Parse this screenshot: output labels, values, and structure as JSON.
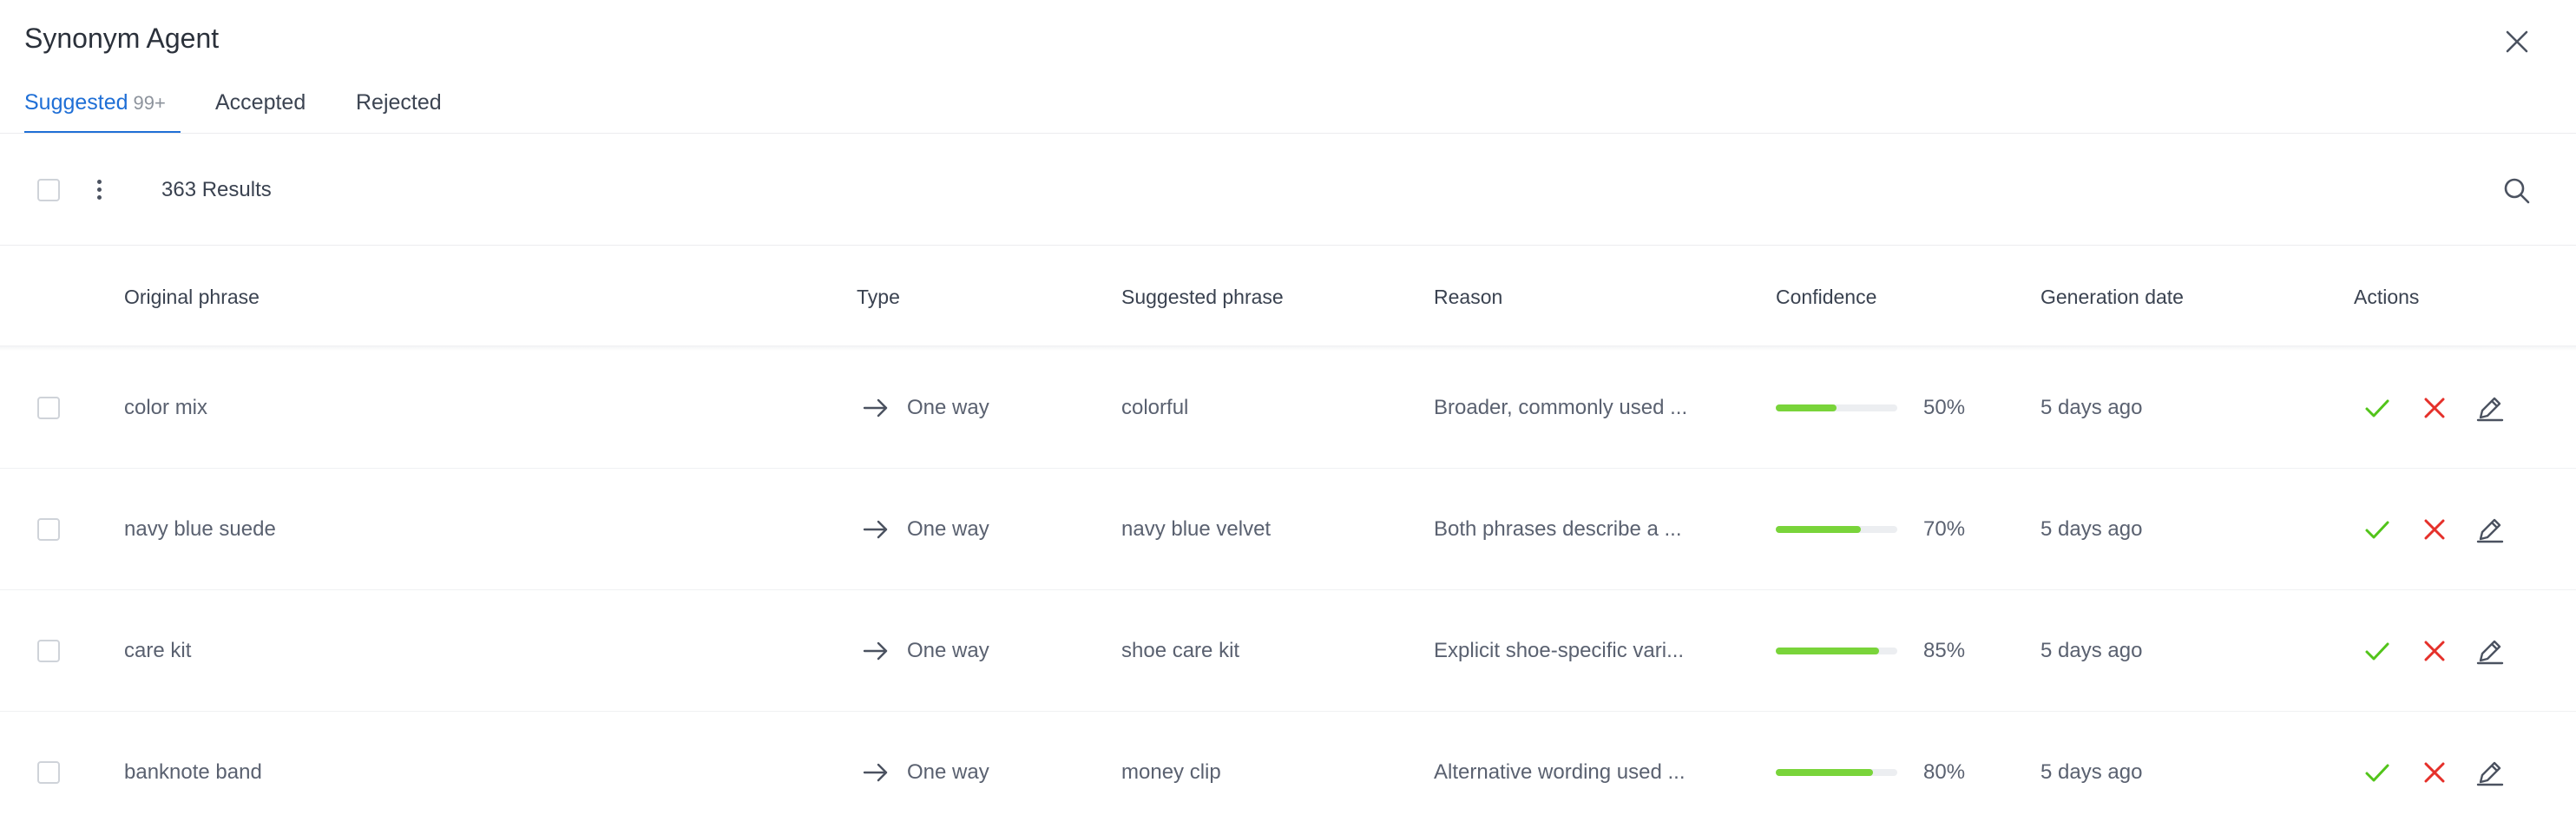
{
  "app": {
    "title": "Synonym Agent"
  },
  "tabs": [
    {
      "label": "Suggested",
      "badge": "99+",
      "active": true
    },
    {
      "label": "Accepted",
      "active": false
    },
    {
      "label": "Rejected",
      "active": false
    }
  ],
  "toolbar": {
    "results_text": "363 Results"
  },
  "table": {
    "columns": [
      "Original phrase",
      "Type",
      "Suggested phrase",
      "Reason",
      "Confidence",
      "Generation date",
      "Actions"
    ],
    "rows": [
      {
        "original": "color mix",
        "type": "One way",
        "suggested": "colorful",
        "reason": "Broader, commonly used ...",
        "confidence": 50,
        "confidence_label": "50%",
        "date": "5 days ago"
      },
      {
        "original": "navy blue suede",
        "type": "One way",
        "suggested": "navy blue velvet",
        "reason": "Both phrases describe a ...",
        "confidence": 70,
        "confidence_label": "70%",
        "date": "5 days ago"
      },
      {
        "original": "care kit",
        "type": "One way",
        "suggested": "shoe care kit",
        "reason": "Explicit shoe-specific vari...",
        "confidence": 85,
        "confidence_label": "85%",
        "date": "5 days ago"
      },
      {
        "original": "banknote band",
        "type": "One way",
        "suggested": "money clip",
        "reason": "Alternative wording used ...",
        "confidence": 80,
        "confidence_label": "80%",
        "date": "5 days ago"
      }
    ]
  },
  "icons": {
    "close": "close-icon",
    "search": "search-icon",
    "more": "more-vertical-icon",
    "type": "arrow-right-icon",
    "accept": "check-icon",
    "reject": "x-icon",
    "edit": "pencil-icon"
  },
  "colors": {
    "accent": "#1f6fd6",
    "accept": "#52c41a",
    "reject": "#e5302a",
    "bar_fill": "#79d43a",
    "bar_track": "#eceef1"
  }
}
